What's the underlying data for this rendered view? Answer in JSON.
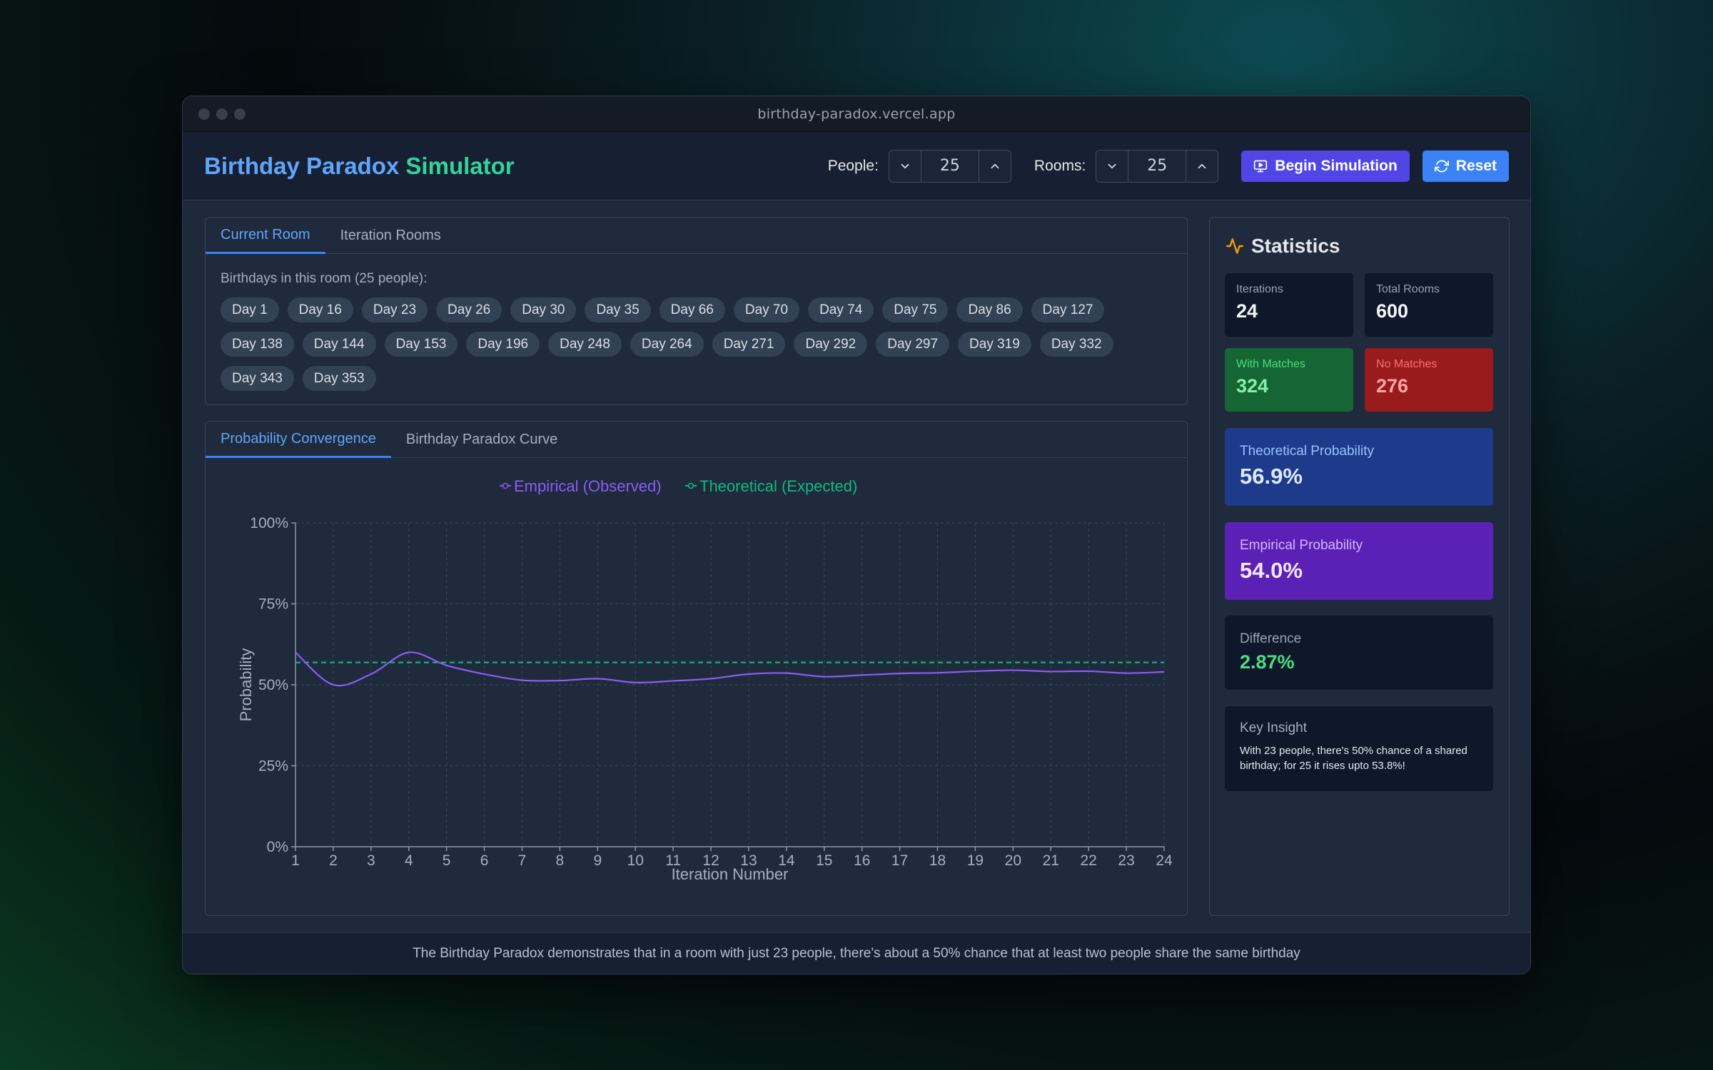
{
  "browser": {
    "url": "birthday-paradox.vercel.app"
  },
  "header": {
    "title_part1": "Birthday Paradox",
    "title_part2": "Simulator",
    "people_label": "People:",
    "people_value": "25",
    "rooms_label": "Rooms:",
    "rooms_value": "25",
    "begin_label": "Begin Simulation",
    "reset_label": "Reset"
  },
  "room_panel": {
    "tabs": [
      "Current Room",
      "Iteration Rooms"
    ],
    "active_tab": 0,
    "caption": "Birthdays in this room (25 people):",
    "birthdays": [
      "Day 1",
      "Day 16",
      "Day 23",
      "Day 26",
      "Day 30",
      "Day 35",
      "Day 66",
      "Day 70",
      "Day 74",
      "Day 75",
      "Day 86",
      "Day 127",
      "Day 138",
      "Day 144",
      "Day 153",
      "Day 196",
      "Day 248",
      "Day 264",
      "Day 271",
      "Day 292",
      "Day 297",
      "Day 319",
      "Day 332",
      "Day 343",
      "Day 353"
    ]
  },
  "chart_panel": {
    "tabs": [
      "Probability Convergence",
      "Birthday Paradox Curve"
    ],
    "active_tab": 0
  },
  "chart_data": {
    "type": "line",
    "title": "",
    "xlabel": "Iteration Number",
    "ylabel": "Probability",
    "x": [
      1,
      2,
      3,
      4,
      5,
      6,
      7,
      8,
      9,
      10,
      11,
      12,
      13,
      14,
      15,
      16,
      17,
      18,
      19,
      20,
      21,
      22,
      23,
      24
    ],
    "ylim": [
      0,
      100
    ],
    "yticks": [
      "0%",
      "25%",
      "50%",
      "75%",
      "100%"
    ],
    "ytick_values": [
      0,
      25,
      50,
      75,
      100
    ],
    "grid": true,
    "legend_position": "top-center",
    "series": [
      {
        "name": "Empirical (Observed)",
        "color": "#8b5cf6",
        "style": "solid",
        "values": [
          60.0,
          50.0,
          53.3,
          60.0,
          56.0,
          53.3,
          51.4,
          51.3,
          51.9,
          50.7,
          51.2,
          51.9,
          53.3,
          53.6,
          52.5,
          53.0,
          53.5,
          53.7,
          54.2,
          54.5,
          54.1,
          54.2,
          53.6,
          54.0
        ]
      },
      {
        "name": "Theoretical (Expected)",
        "color": "#10b981",
        "style": "dashed",
        "values": [
          56.9,
          56.9,
          56.9,
          56.9,
          56.9,
          56.9,
          56.9,
          56.9,
          56.9,
          56.9,
          56.9,
          56.9,
          56.9,
          56.9,
          56.9,
          56.9,
          56.9,
          56.9,
          56.9,
          56.9,
          56.9,
          56.9,
          56.9,
          56.9
        ]
      }
    ]
  },
  "stats": {
    "title": "Statistics",
    "iterations_label": "Iterations",
    "iterations_value": "24",
    "total_rooms_label": "Total Rooms",
    "total_rooms_value": "600",
    "with_matches_label": "With Matches",
    "with_matches_value": "324",
    "no_matches_label": "No Matches",
    "no_matches_value": "276",
    "theoretical_label": "Theoretical Probability",
    "theoretical_value": "56.9%",
    "empirical_label": "Empirical Probability",
    "empirical_value": "54.0%",
    "difference_label": "Difference",
    "difference_value": "2.87%",
    "insight_title": "Key Insight",
    "insight_text": "With 23 people, there's 50% chance of a shared birthday; for 25 it rises upto 53.8%!"
  },
  "footer": {
    "text": "The Birthday Paradox demonstrates that in a room with just 23 people, there's about a 50% chance that at least two people share the same birthday"
  },
  "colors": {
    "accent_blue": "#3b82f6",
    "accent_indigo": "#4f46e5",
    "empirical": "#8b5cf6",
    "theoretical": "#10b981"
  }
}
